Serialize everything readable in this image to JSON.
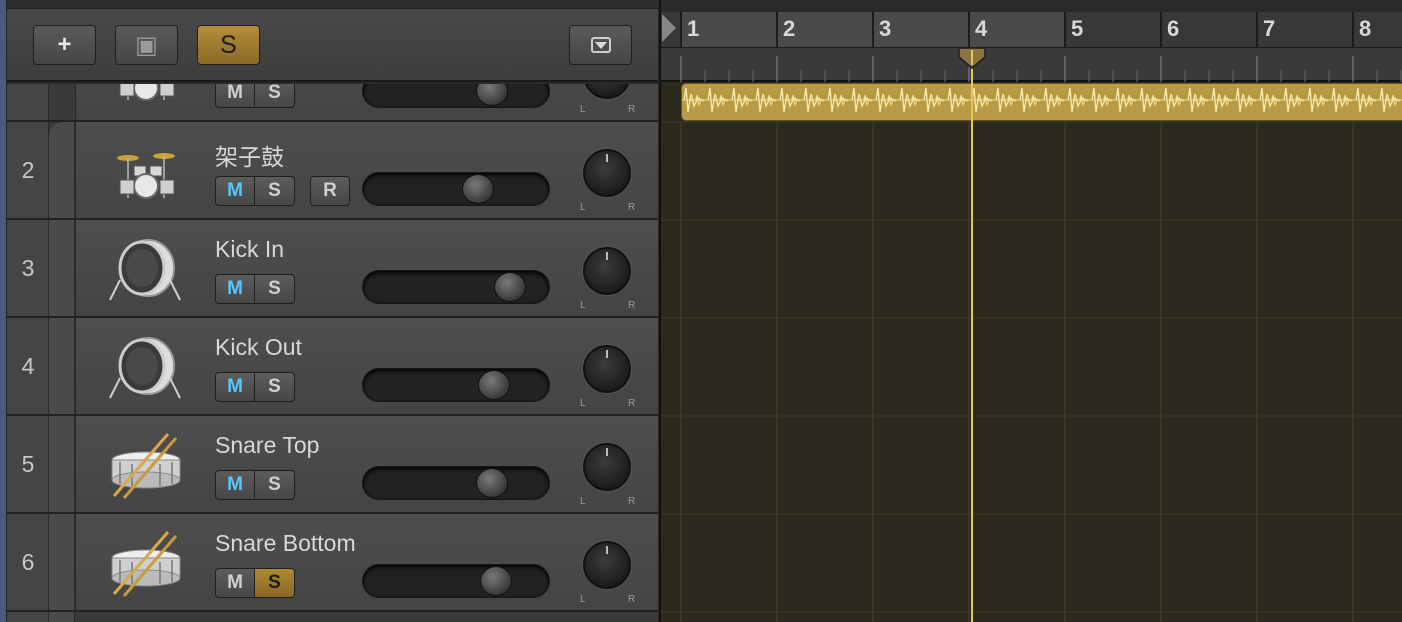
{
  "toolbar": {
    "add_label": "+",
    "folder_label": "▣",
    "solo_label": "S",
    "menu_icon": "dropdown-menu-icon"
  },
  "ruler": {
    "bars": [
      "1",
      "2",
      "3",
      "4",
      "5",
      "6",
      "7",
      "8"
    ]
  },
  "tracks": [
    {
      "number": "",
      "name": "",
      "mute": "M",
      "solo": "S",
      "mute_active": false,
      "solo_active": false,
      "icon": "drum-kit-icon",
      "pan_l": "L",
      "pan_r": "R"
    },
    {
      "number": "2",
      "name": "架子鼓",
      "mute": "M",
      "solo": "S",
      "record": "R",
      "mute_active": true,
      "solo_active": false,
      "icon": "drum-kit-icon",
      "pan_l": "L",
      "pan_r": "R"
    },
    {
      "number": "3",
      "name": "Kick In",
      "mute": "M",
      "solo": "S",
      "mute_active": true,
      "solo_active": false,
      "icon": "kick-drum-icon",
      "pan_l": "L",
      "pan_r": "R"
    },
    {
      "number": "4",
      "name": "Kick Out",
      "mute": "M",
      "solo": "S",
      "mute_active": true,
      "solo_active": false,
      "icon": "kick-drum-icon",
      "pan_l": "L",
      "pan_r": "R"
    },
    {
      "number": "5",
      "name": "Snare Top",
      "mute": "M",
      "solo": "S",
      "mute_active": true,
      "solo_active": false,
      "icon": "snare-drum-icon",
      "pan_l": "L",
      "pan_r": "R"
    },
    {
      "number": "6",
      "name": "Snare Bottom",
      "mute": "M",
      "solo": "S",
      "mute_active": false,
      "solo_active": true,
      "icon": "snare-drum-icon",
      "pan_l": "L",
      "pan_r": "R"
    }
  ],
  "colors": {
    "region": "#b89a45",
    "playhead": "#e8c55a",
    "mute_on": "#56c6ff",
    "solo_on": "#b08934"
  }
}
